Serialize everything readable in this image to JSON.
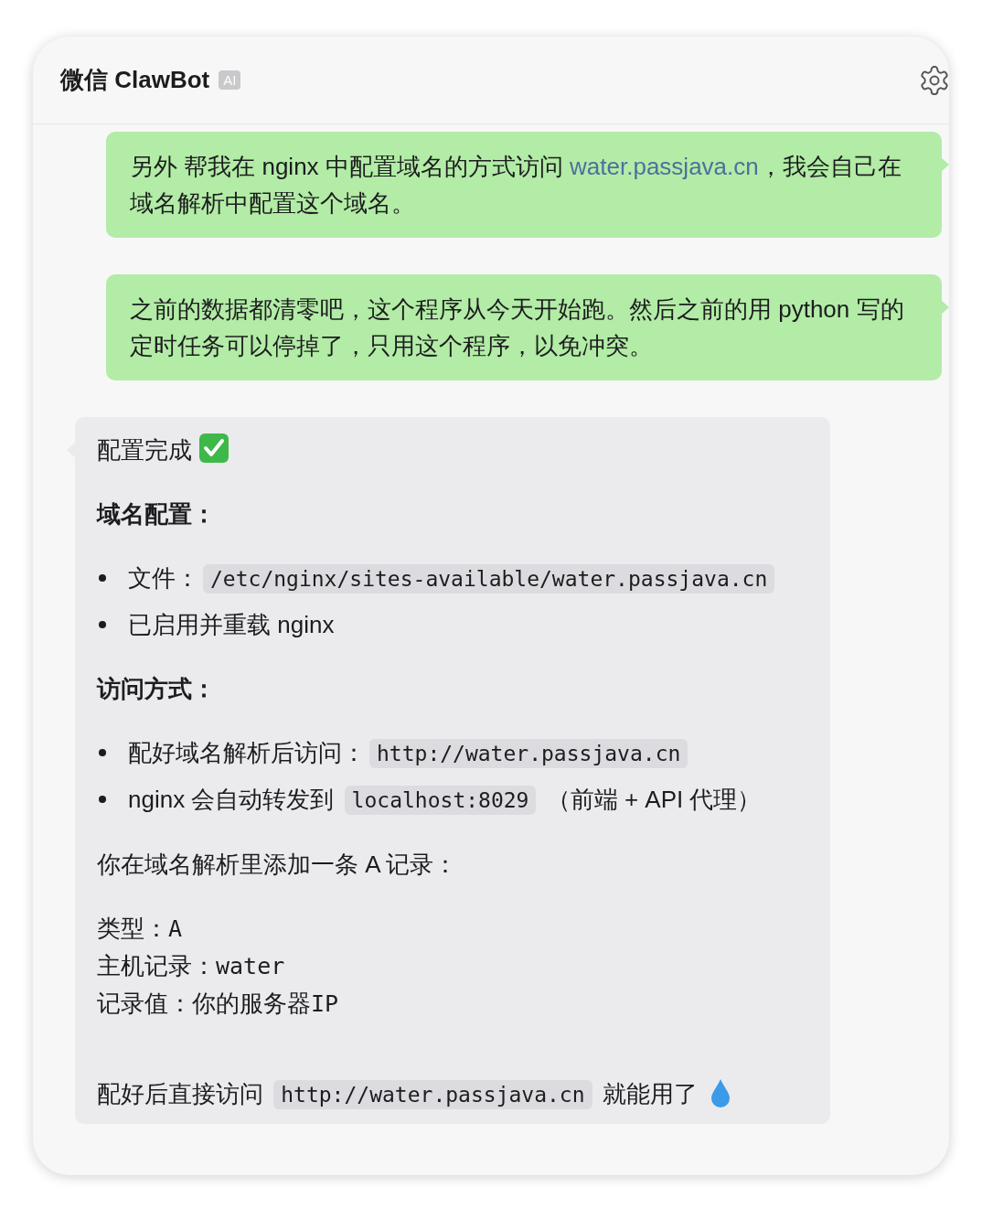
{
  "header": {
    "title": "微信 ClawBot",
    "badge": "AI"
  },
  "messages": [
    {
      "kind": "sent",
      "segments": [
        {
          "kind": "text",
          "text": "另外 帮我在 nginx 中配置域名的方式访问 "
        },
        {
          "kind": "link",
          "text": "water.passjava.cn"
        },
        {
          "kind": "text",
          "text": "，我会自己在域名解析中配置这个域名。"
        }
      ]
    },
    {
      "kind": "sent",
      "segments": [
        {
          "kind": "text",
          "text": "之前的数据都清零吧，这个程序从今天开始跑。然后之前的用 python 写的定时任务可以停掉了，只用这个程序，以免冲突。"
        }
      ]
    },
    {
      "kind": "received",
      "blocks": [
        {
          "kind": "paragraph",
          "segments": [
            {
              "kind": "text",
              "text": "配置完成 "
            },
            {
              "kind": "check"
            }
          ]
        },
        {
          "kind": "heading",
          "text": "域名配置："
        },
        {
          "kind": "list",
          "items": [
            {
              "segments": [
                {
                  "kind": "text",
                  "text": "文件："
                },
                {
                  "kind": "code",
                  "text": "/etc/nginx/sites-available/water.passjava.cn"
                }
              ]
            },
            {
              "segments": [
                {
                  "kind": "text",
                  "text": "已启用并重载 nginx"
                }
              ]
            }
          ]
        },
        {
          "kind": "heading",
          "text": "访问方式："
        },
        {
          "kind": "list",
          "items": [
            {
              "segments": [
                {
                  "kind": "text",
                  "text": "配好域名解析后访问："
                },
                {
                  "kind": "code",
                  "text": "http://water.passjava.cn"
                }
              ]
            },
            {
              "segments": [
                {
                  "kind": "text",
                  "text": "nginx 会自动转发到 "
                },
                {
                  "kind": "code",
                  "text": "localhost:8029"
                },
                {
                  "kind": "text",
                  "text": " （前端 + API 代理）"
                }
              ]
            }
          ]
        },
        {
          "kind": "paragraph",
          "segments": [
            {
              "kind": "text",
              "text": "你在域名解析里添加一条 A 记录："
            }
          ]
        },
        {
          "kind": "lines",
          "lines": [
            [
              {
                "kind": "text",
                "text": "类型："
              },
              {
                "kind": "mono",
                "text": "A"
              }
            ],
            [
              {
                "kind": "text",
                "text": "主机记录："
              },
              {
                "kind": "mono",
                "text": "water"
              }
            ],
            [
              {
                "kind": "text",
                "text": "记录值：你的服务器"
              },
              {
                "kind": "mono",
                "text": "IP"
              }
            ]
          ]
        },
        {
          "kind": "paragraph",
          "segments": [
            {
              "kind": "text",
              "text": "配好后直接访问 "
            },
            {
              "kind": "code",
              "text": "http://water.passjava.cn"
            },
            {
              "kind": "text",
              "text": " 就能用了 "
            },
            {
              "kind": "drop"
            }
          ]
        }
      ]
    }
  ]
}
